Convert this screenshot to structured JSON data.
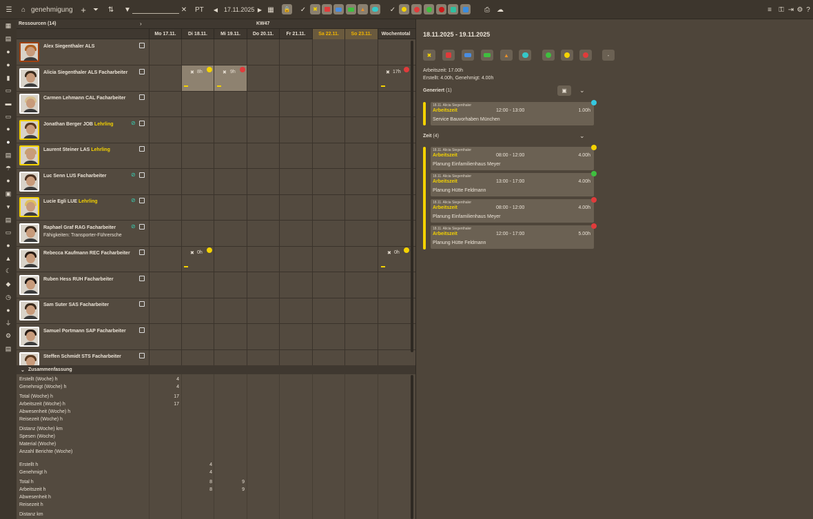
{
  "topbar": {
    "title": "genehmigung",
    "mode": "PT",
    "date": "17.11.2025",
    "search_value": "",
    "icons": [
      "menu-icon",
      "home-icon",
      "add-icon",
      "filter-funnel-icon",
      "sort-add-icon",
      "filter-icon",
      "clear-icon",
      "prev-icon",
      "next-icon",
      "calendar-icon",
      "lock-icon",
      "check-icon"
    ],
    "right_icons": [
      "sliders-icon",
      "key-icon",
      "logout-icon",
      "gear-icon",
      "help-icon"
    ]
  },
  "grid": {
    "resources_label": "Ressourcen (14)",
    "week_label": "KW47",
    "days": [
      {
        "label": "Mo 17.11.",
        "weekend": false
      },
      {
        "label": "Di 18.11.",
        "weekend": false
      },
      {
        "label": "Mi 19.11.",
        "weekend": false
      },
      {
        "label": "Do 20.11.",
        "weekend": false
      },
      {
        "label": "Fr 21.11.",
        "weekend": false
      },
      {
        "label": "Sa 22.11.",
        "weekend": true
      },
      {
        "label": "So 23.11.",
        "weekend": true
      },
      {
        "label": "Wochentotal",
        "weekend": false
      }
    ],
    "people": [
      {
        "name": "Alex Siegenthaler ALS",
        "role": "",
        "role_color": "",
        "skill": "",
        "clip": false
      },
      {
        "name": "Alicia Siegenthaler ALS",
        "role": "Facharbeiter",
        "role_color": "w",
        "skill": "",
        "clip": false
      },
      {
        "name": "Carmen Lehmann CAL",
        "role": "Facharbeiter",
        "role_color": "w",
        "skill": "",
        "clip": false
      },
      {
        "name": "Jonathan Berger JOB",
        "role": "Lehrling",
        "role_color": "y",
        "skill": "",
        "clip": true
      },
      {
        "name": "Laurent Steiner LAS",
        "role": "Lehrling",
        "role_color": "y",
        "skill": "",
        "clip": false
      },
      {
        "name": "Luc Senn LUS",
        "role": "Facharbeiter",
        "role_color": "w",
        "skill": "",
        "clip": true
      },
      {
        "name": "Lucie Egli LUE",
        "role": "Lehrling",
        "role_color": "y",
        "skill": "",
        "clip": true
      },
      {
        "name": "Raphael Graf RAG",
        "role": "Facharbeiter",
        "role_color": "w",
        "skill": "Fähigkeiten: Transporter-Führersche",
        "clip": true
      },
      {
        "name": "Rebecca Kaufmann REC",
        "role": "Facharbeiter",
        "role_color": "w",
        "skill": "",
        "clip": false
      },
      {
        "name": "Ruben Hess RUH",
        "role": "Facharbeiter",
        "role_color": "w",
        "skill": "",
        "clip": false
      },
      {
        "name": "Sam Suter SAS",
        "role": "Facharbeiter",
        "role_color": "w",
        "skill": "",
        "clip": false
      },
      {
        "name": "Samuel Portmann SAP",
        "role": "Facharbeiter",
        "role_color": "w",
        "skill": "",
        "clip": false
      },
      {
        "name": "Steffen Schmidt STS",
        "role": "Facharbeiter",
        "role_color": "w",
        "skill": "",
        "clip": false
      }
    ],
    "cells": {
      "alicia_di": "8h",
      "alicia_mi": "9h",
      "alicia_total": "17h",
      "rebecca_di": "0h",
      "rebecca_total": "0h"
    }
  },
  "summary": {
    "title": "Zusammenfassung",
    "rows": [
      {
        "label": "Erstellt (Woche) h",
        "mo": "4",
        "di": "",
        "mi": ""
      },
      {
        "label": "Genehmigt (Woche) h",
        "mo": "4",
        "di": "",
        "mi": ""
      },
      {
        "label": "Total (Woche) h",
        "mo": "17",
        "di": "",
        "mi": ""
      },
      {
        "label": "Arbeitszeit (Woche) h",
        "mo": "17",
        "di": "",
        "mi": ""
      },
      {
        "label": "Abwesenheit (Woche) h",
        "mo": "",
        "di": "",
        "mi": ""
      },
      {
        "label": "Reisezeit (Woche) h",
        "mo": "",
        "di": "",
        "mi": ""
      },
      {
        "label": "Distanz (Woche) km",
        "mo": "",
        "di": "",
        "mi": ""
      },
      {
        "label": "Spesen (Woche)",
        "mo": "",
        "di": "",
        "mi": ""
      },
      {
        "label": "Material (Woche)",
        "mo": "",
        "di": "",
        "mi": ""
      },
      {
        "label": "Anzahl Berichte (Woche)",
        "mo": "",
        "di": "",
        "mi": ""
      },
      {
        "label": "Erstellt h",
        "mo": "",
        "di": "4",
        "mi": ""
      },
      {
        "label": "Genehmigt h",
        "mo": "",
        "di": "4",
        "mi": ""
      },
      {
        "label": "Total h",
        "mo": "",
        "di": "8",
        "mi": "9"
      },
      {
        "label": "Arbeitszeit h",
        "mo": "",
        "di": "8",
        "mi": "9"
      },
      {
        "label": "Abwesenheit h",
        "mo": "",
        "di": "",
        "mi": ""
      },
      {
        "label": "Reisezeit h",
        "mo": "",
        "di": "",
        "mi": ""
      },
      {
        "label": "Distanz km",
        "mo": "",
        "di": "",
        "mi": ""
      }
    ]
  },
  "detail": {
    "range": "18.11.2025 - 19.11.2025",
    "arbeitszeit": "Arbeitszeit: 17.00h",
    "erstellt": "Erstellt: 4.00h, Genehmigt: 4.00h",
    "minus_label": "-",
    "generiert_label": "Generiert",
    "generiert_count": "(1)",
    "zeit_label": "Zeit",
    "zeit_count": "(4)",
    "generiert_cards": [
      {
        "who": "18.11. Alicia Siegenthaler",
        "type": "Arbeitszeit",
        "time": "12:00 - 13:00",
        "hours": "1.00h",
        "desc": "Service Bauvorhaben München",
        "badge": "#35c8e0"
      }
    ],
    "zeit_cards": [
      {
        "who": "18.11. Alicia Siegenthaler",
        "type": "Arbeitszeit",
        "time": "08:00 - 12:00",
        "hours": "4.00h",
        "desc": "Planung Einfamilienhaus Meyer",
        "badge": "#f4d200"
      },
      {
        "who": "18.11. Alicia Siegenthaler",
        "type": "Arbeitszeit",
        "time": "13:00 - 17:00",
        "hours": "4.00h",
        "desc": "Planung Hütte Feldmann",
        "badge": "#3fbf3f"
      },
      {
        "who": "18.11. Alicia Siegenthaler",
        "type": "Arbeitszeit",
        "time": "08:00 - 12:00",
        "hours": "4.00h",
        "desc": "Planung Einfamilienhaus Meyer",
        "badge": "#e03b3b"
      },
      {
        "who": "18.11. Alicia Siegenthaler",
        "type": "Arbeitszeit",
        "time": "12:00 - 17:00",
        "hours": "5.00h",
        "desc": "Planung Hütte Feldmann",
        "badge": "#e03b3b"
      }
    ]
  },
  "colors": {
    "accent": "#f4d200",
    "weekend": "#f1b400",
    "approved": "#3fbf3f",
    "rejected": "#e03b3b",
    "generated": "#35c8e0"
  }
}
